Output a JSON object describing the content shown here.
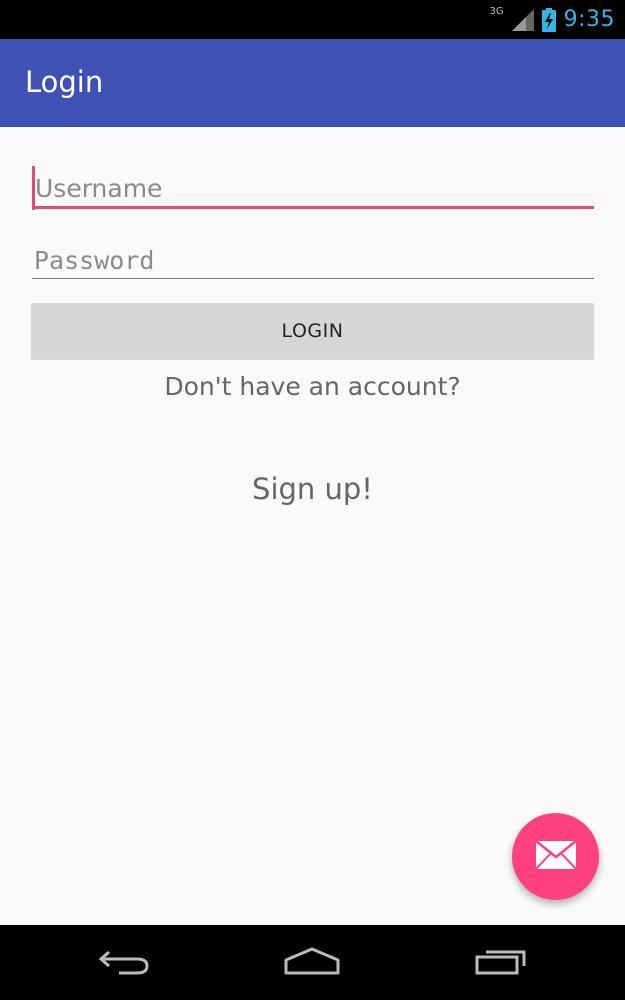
{
  "status_bar": {
    "network_type": "3G",
    "time": "9:35",
    "icons": [
      "signal-icon",
      "battery-charging-icon"
    ]
  },
  "app_bar": {
    "title": "Login"
  },
  "form": {
    "username_placeholder": "Username",
    "username_value": "",
    "password_placeholder": "Password",
    "password_value": "",
    "login_label": "LOGIN"
  },
  "account_prompt": "Don't have an account?",
  "signup_label": "Sign up!",
  "fab": {
    "icon": "email-icon"
  },
  "nav_bar": {
    "icons": [
      "back-icon",
      "home-icon",
      "recent-apps-icon"
    ]
  },
  "colors": {
    "primary": "#3f51b5",
    "accent": "#ff4081",
    "status_text": "#33b5e5",
    "field_focus": "#e04a7e",
    "button_bg": "#d6d6d6",
    "background": "#fafafa"
  }
}
